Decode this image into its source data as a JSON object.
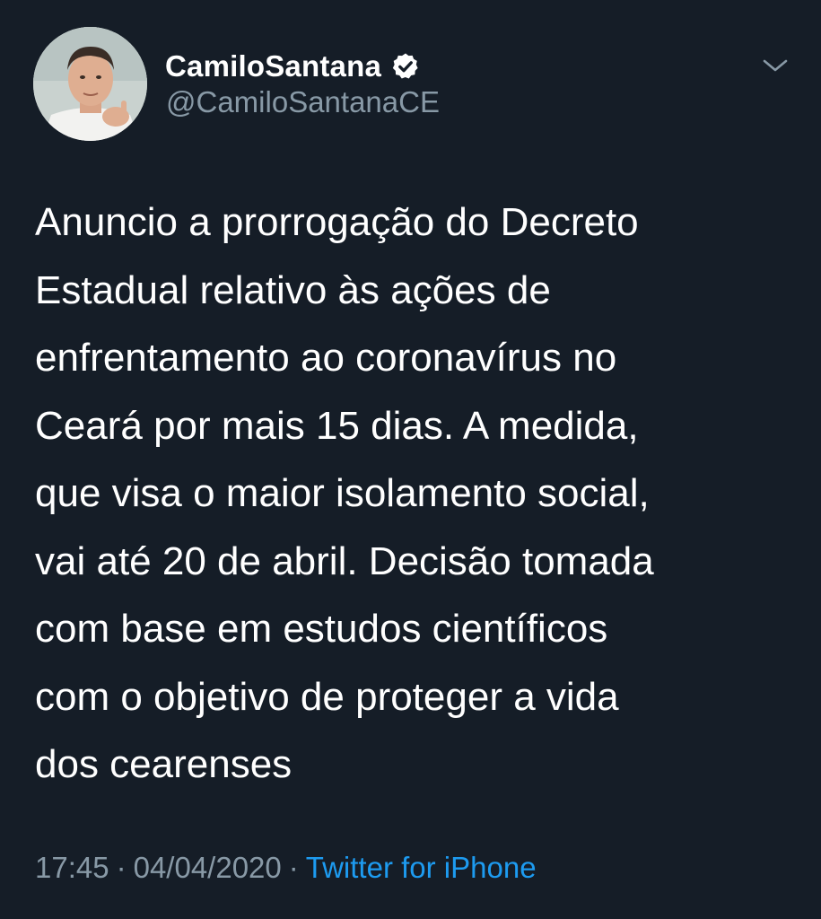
{
  "tweet": {
    "author": {
      "display_name": "CamiloSantana",
      "handle": "@CamiloSantanaCE",
      "verified_icon": "verified-badge-icon"
    },
    "menu_icon": "chevron-down-icon",
    "text": "Anuncio a prorrogação do Decreto\nEstadual relativo às ações de\nenfrentamento ao coronavírus no\nCeará por mais 15 dias. A medida,\nque visa o maior isolamento social,\nvai até 20 de abril. Decisão tomada\ncom base em estudos científicos\ncom o objetivo de proteger a vida\ndos cearenses",
    "time": "17:45",
    "separator": "·",
    "date": "04/04/2020",
    "source": "Twitter for iPhone"
  },
  "colors": {
    "background": "#151d27",
    "text": "#ffffff",
    "muted": "#8899a6",
    "link": "#1d9bf0"
  }
}
